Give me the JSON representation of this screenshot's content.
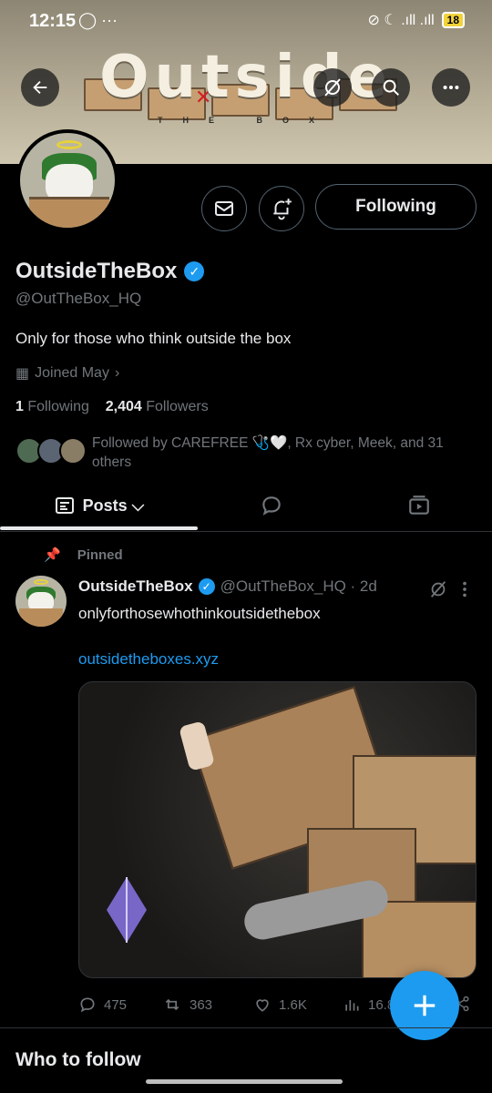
{
  "status_bar": {
    "time": "12:15",
    "left_icons": "◯ ···",
    "right_icons": "⊘ ☾ .ıll .ıll ",
    "battery": "18"
  },
  "banner": {
    "title": "Outside",
    "subtitle": "THE BOX"
  },
  "profile": {
    "name": "OutsideTheBox",
    "handle": "@OutTheBox_HQ",
    "bio": "Only for those who think outside the box",
    "joined": "Joined May",
    "following_count": "1",
    "following_label": "Following",
    "followers_count": "2,404",
    "followers_label": "Followers",
    "followed_by": "Followed by CAREFREE 🩺🤍, Rx cyber, Meek, and 31 others",
    "follow_button": "Following"
  },
  "tabs": [
    {
      "label": "Posts ⌵"
    },
    {
      "label": ""
    },
    {
      "label": ""
    }
  ],
  "post": {
    "pinned_label": "Pinned",
    "author": "OutsideTheBox",
    "handle_time": "@OutTheBox_HQ · 2d",
    "text": "onlyforthosewhothinkoutsidethebox",
    "link": "outsidetheboxes.xyz",
    "replies": "475",
    "reposts": "363",
    "likes": "1.6K",
    "views": "16.8"
  },
  "section": {
    "who_to_follow": "Who to follow"
  },
  "colors": {
    "accent": "#1d9bf0",
    "background": "#000000",
    "muted": "#71767b"
  }
}
